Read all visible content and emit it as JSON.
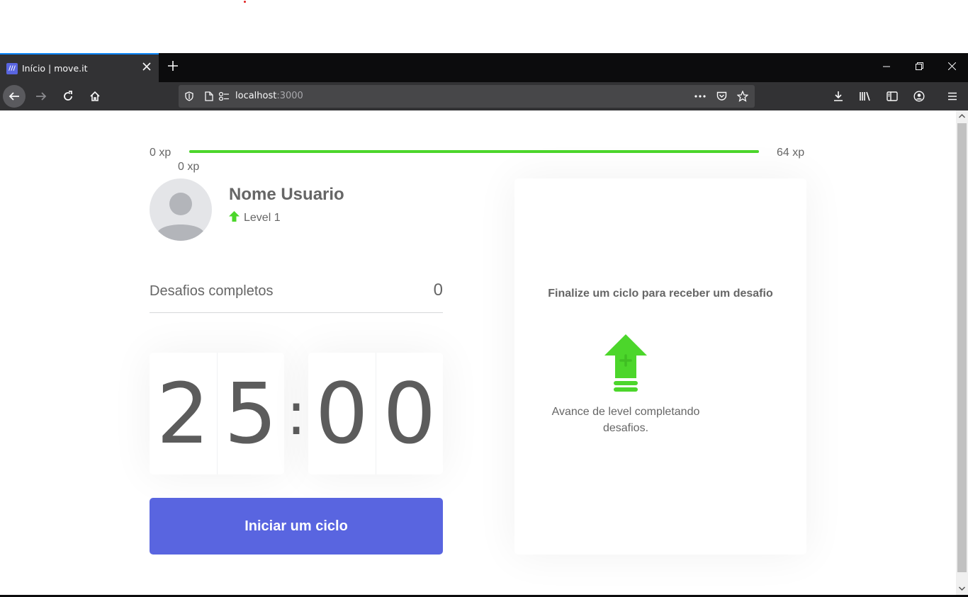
{
  "browser": {
    "tab_title": "Início | move.it",
    "favicon_letters": "///",
    "url_host": "localhost",
    "url_port": ":3000"
  },
  "icons": {
    "tab_close": "close-icon",
    "new_tab": "plus-icon",
    "back": "arrow-left-icon",
    "forward": "arrow-right-icon",
    "reload": "reload-icon",
    "home": "home-icon",
    "shield": "shield-icon",
    "page": "page-icon",
    "permissions": "permissions-icon",
    "page_actions": "more-icon",
    "pocket": "pocket-icon",
    "bookmark": "star-icon",
    "downloads": "download-icon",
    "library": "library-icon",
    "sidebar": "sidebar-icon",
    "account": "account-icon",
    "menu": "hamburger-icon"
  },
  "colors": {
    "accent": "#5965e0",
    "green": "#4cd62b",
    "text": "#666666",
    "tab_indicator": "#0a84ff"
  },
  "experience": {
    "min_label": "0 xp",
    "max_label": "64 xp",
    "current_label": "0 xp",
    "progress_fraction": 1.0
  },
  "profile": {
    "name": "Nome Usuario",
    "level": "Level 1"
  },
  "completed_challenges": {
    "label": "Desafios completos",
    "value": "0"
  },
  "countdown": {
    "minute_left": "2",
    "minute_right": "5",
    "separator": ":",
    "second_left": "0",
    "second_right": "0"
  },
  "start_button": {
    "label": "Iniciar um ciclo"
  },
  "challenge_box": {
    "title": "Finalize um ciclo para receber um desafio",
    "description": "Avance de level completando desafios."
  }
}
